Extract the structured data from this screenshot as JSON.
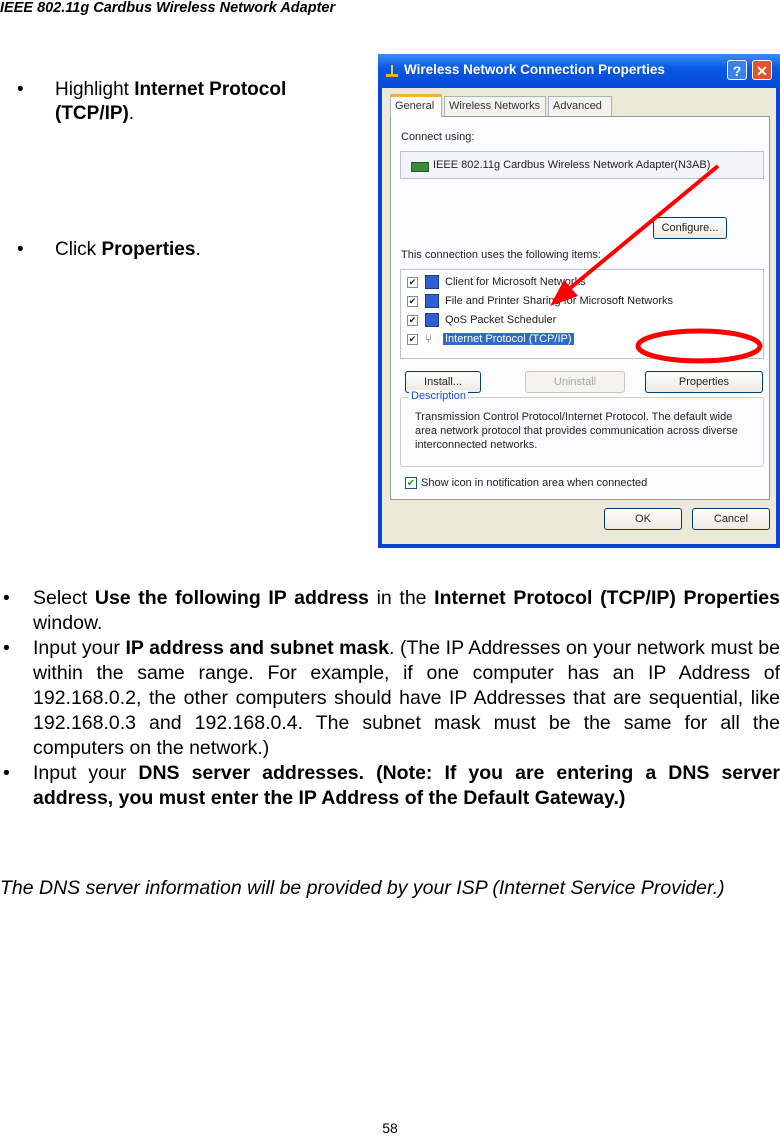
{
  "header": {
    "title": "IEEE 802.11g Cardbus Wireless Network Adapter"
  },
  "side_steps": [
    {
      "bullet": "•",
      "prefix": "Highlight ",
      "bold": "Internet Protocol (TCP/IP)",
      "suffix": "."
    },
    {
      "bullet": "•",
      "prefix": "Click ",
      "bold": "Properties",
      "suffix": "."
    }
  ],
  "dialog": {
    "title": "Wireless Network Connection Properties",
    "help_button": "?",
    "close_button": "✕",
    "tabs": [
      {
        "label": "General",
        "active": true
      },
      {
        "label": "Wireless Networks",
        "active": false
      },
      {
        "label": "Advanced",
        "active": false
      }
    ],
    "connect_using_label": "Connect using:",
    "adapter_name": "IEEE 802.11g Cardbus Wireless Network Adapter(N3AB)",
    "configure_button": "Configure...",
    "items_label": "This connection uses the following items:",
    "items": [
      {
        "label": "Client for Microsoft Networks",
        "checked": true,
        "selected": false,
        "icon": "client-icon"
      },
      {
        "label": "File and Printer Sharing for Microsoft Networks",
        "checked": true,
        "selected": false,
        "icon": "service-icon"
      },
      {
        "label": "QoS Packet Scheduler",
        "checked": true,
        "selected": false,
        "icon": "service-icon"
      },
      {
        "label": "Internet Protocol (TCP/IP)",
        "checked": true,
        "selected": true,
        "icon": "protocol-icon"
      }
    ],
    "install_button": "Install...",
    "uninstall_button": "Uninstall",
    "properties_button": "Properties",
    "description_title": "Description",
    "description_text": "Transmission Control Protocol/Internet Protocol. The default wide area network protocol that provides communication across diverse interconnected networks.",
    "show_icon_label": "Show icon in notification area when connected",
    "show_icon_checked": true,
    "ok_button": "OK",
    "cancel_button": "Cancel",
    "annotation_color": "#ff0000"
  },
  "instructions": [
    {
      "parts": [
        {
          "t": "Select "
        },
        {
          "t": "Use the following IP address",
          "b": true
        },
        {
          "t": " in the "
        },
        {
          "t": "Internet Protocol (TCP/IP) Properties",
          "b": true
        },
        {
          "t": " window."
        }
      ]
    },
    {
      "parts": [
        {
          "t": "Input your "
        },
        {
          "t": "IP address and subnet mask",
          "b": true
        },
        {
          "t": ". (The IP Addresses on your network must be within the same range. For example, if one computer has an IP Address of 192.168.0.2, the other computers should have IP Addresses that are sequential, like 192.168.0.3 and 192.168.0.4.  The subnet mask must be the same for all the computers on the network.)"
        }
      ]
    },
    {
      "parts": [
        {
          "t": "Input your "
        },
        {
          "t": "DNS server addresses.  (Note:  If you are entering a DNS server address, you must enter the IP Address of the Default Gateway.)",
          "b": true
        }
      ]
    }
  ],
  "note": "The DNS server information will be provided by your ISP (Internet Service Provider.)",
  "page_number": "58"
}
